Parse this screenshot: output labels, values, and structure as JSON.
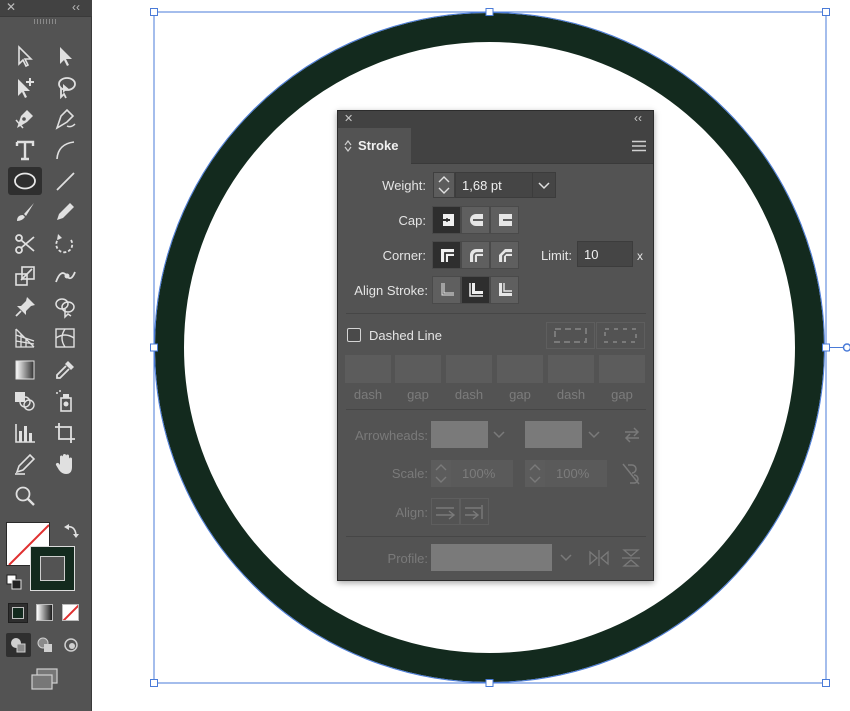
{
  "toolbar": {
    "close_glyph": "✕",
    "collapse_glyph": "‹‹",
    "tools": [
      "selection-tool",
      "direct-selection-tool",
      "add-anchor-tool",
      "lasso-tool",
      "pen-tool",
      "curvature-tool",
      "type-tool",
      "arc-tool",
      "ellipse-tool",
      "line-tool",
      "paintbrush-tool",
      "pencil-tool",
      "scissors-tool",
      "rotate-tool",
      "scale-tool",
      "puppet-warp-tool",
      "pin-tool",
      "shape-builder-tool",
      "perspective-grid-tool",
      "mesh-tool",
      "gradient-tool",
      "eyedropper-tool",
      "blend-tool",
      "symbol-sprayer-tool",
      "column-graph-tool",
      "artboard-tool",
      "slice-tool",
      "hand-tool",
      "zoom-tool"
    ],
    "active_tool": "ellipse-tool",
    "fill_color": "#ffffff",
    "stroke_color": "#132a1e"
  },
  "canvas": {
    "circle_stroke_color": "#132a1e",
    "selection_color": "#4a7bd8"
  },
  "stroke_panel": {
    "close_glyph": "✕",
    "collapse_glyph": "‹‹",
    "tab_label": "Stroke",
    "menu_icon": "hamburger-icon",
    "weight_label": "Weight:",
    "weight_value": "1,68 pt",
    "cap_label": "Cap:",
    "cap_selected": "butt",
    "corner_label": "Corner:",
    "corner_selected": "miter",
    "limit_label": "Limit:",
    "limit_value": "10",
    "limit_unit": "x",
    "align_stroke_label": "Align Stroke:",
    "align_selected": "inside",
    "dashed_line_label": "Dashed Line",
    "dashed_line_checked": false,
    "dash_gap_labels": [
      "dash",
      "gap",
      "dash",
      "gap",
      "dash",
      "gap"
    ],
    "arrowheads_label": "Arrowheads:",
    "scale_label": "Scale:",
    "scale_start": "100%",
    "scale_end": "100%",
    "align_label": "Align:",
    "profile_label": "Profile:"
  }
}
